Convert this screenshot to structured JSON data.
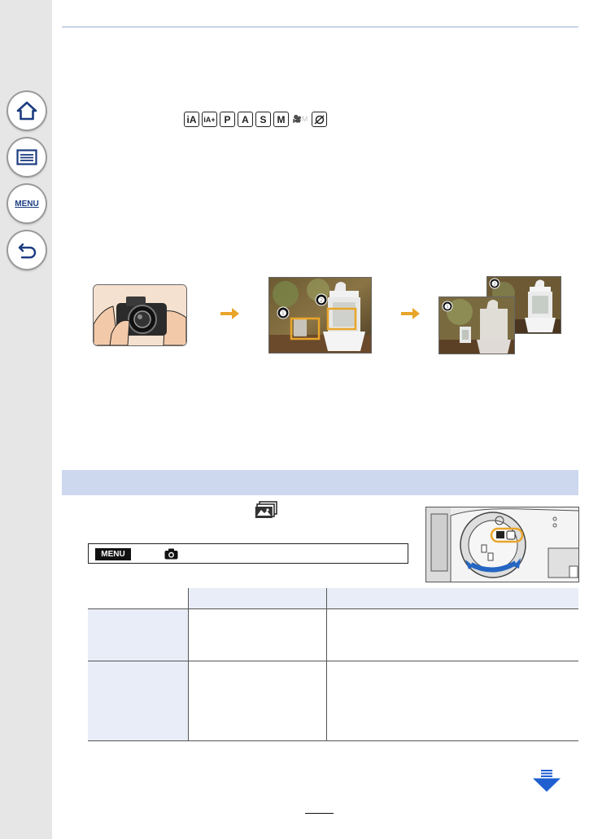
{
  "sidebar": {
    "buttons": [
      {
        "name": "home-button",
        "icon": "home-icon"
      },
      {
        "name": "contents-button",
        "icon": "list-icon"
      },
      {
        "name": "menu-button",
        "label": "MENU"
      },
      {
        "name": "back-button",
        "icon": "return-icon"
      }
    ]
  },
  "modes": {
    "icons": [
      "iA",
      "iA+",
      "P",
      "A",
      "S",
      "M",
      "🎥M",
      "creative"
    ]
  },
  "illustration": {
    "labels": [
      "❶",
      "❷"
    ]
  },
  "menu_path": {
    "badge": "MENU",
    "icon": "camera-icon"
  },
  "colors": {
    "accent_band": "#cdd8ef",
    "highlight_orange": "#e9a52a",
    "nav_arrow": "#1f5fd0"
  }
}
